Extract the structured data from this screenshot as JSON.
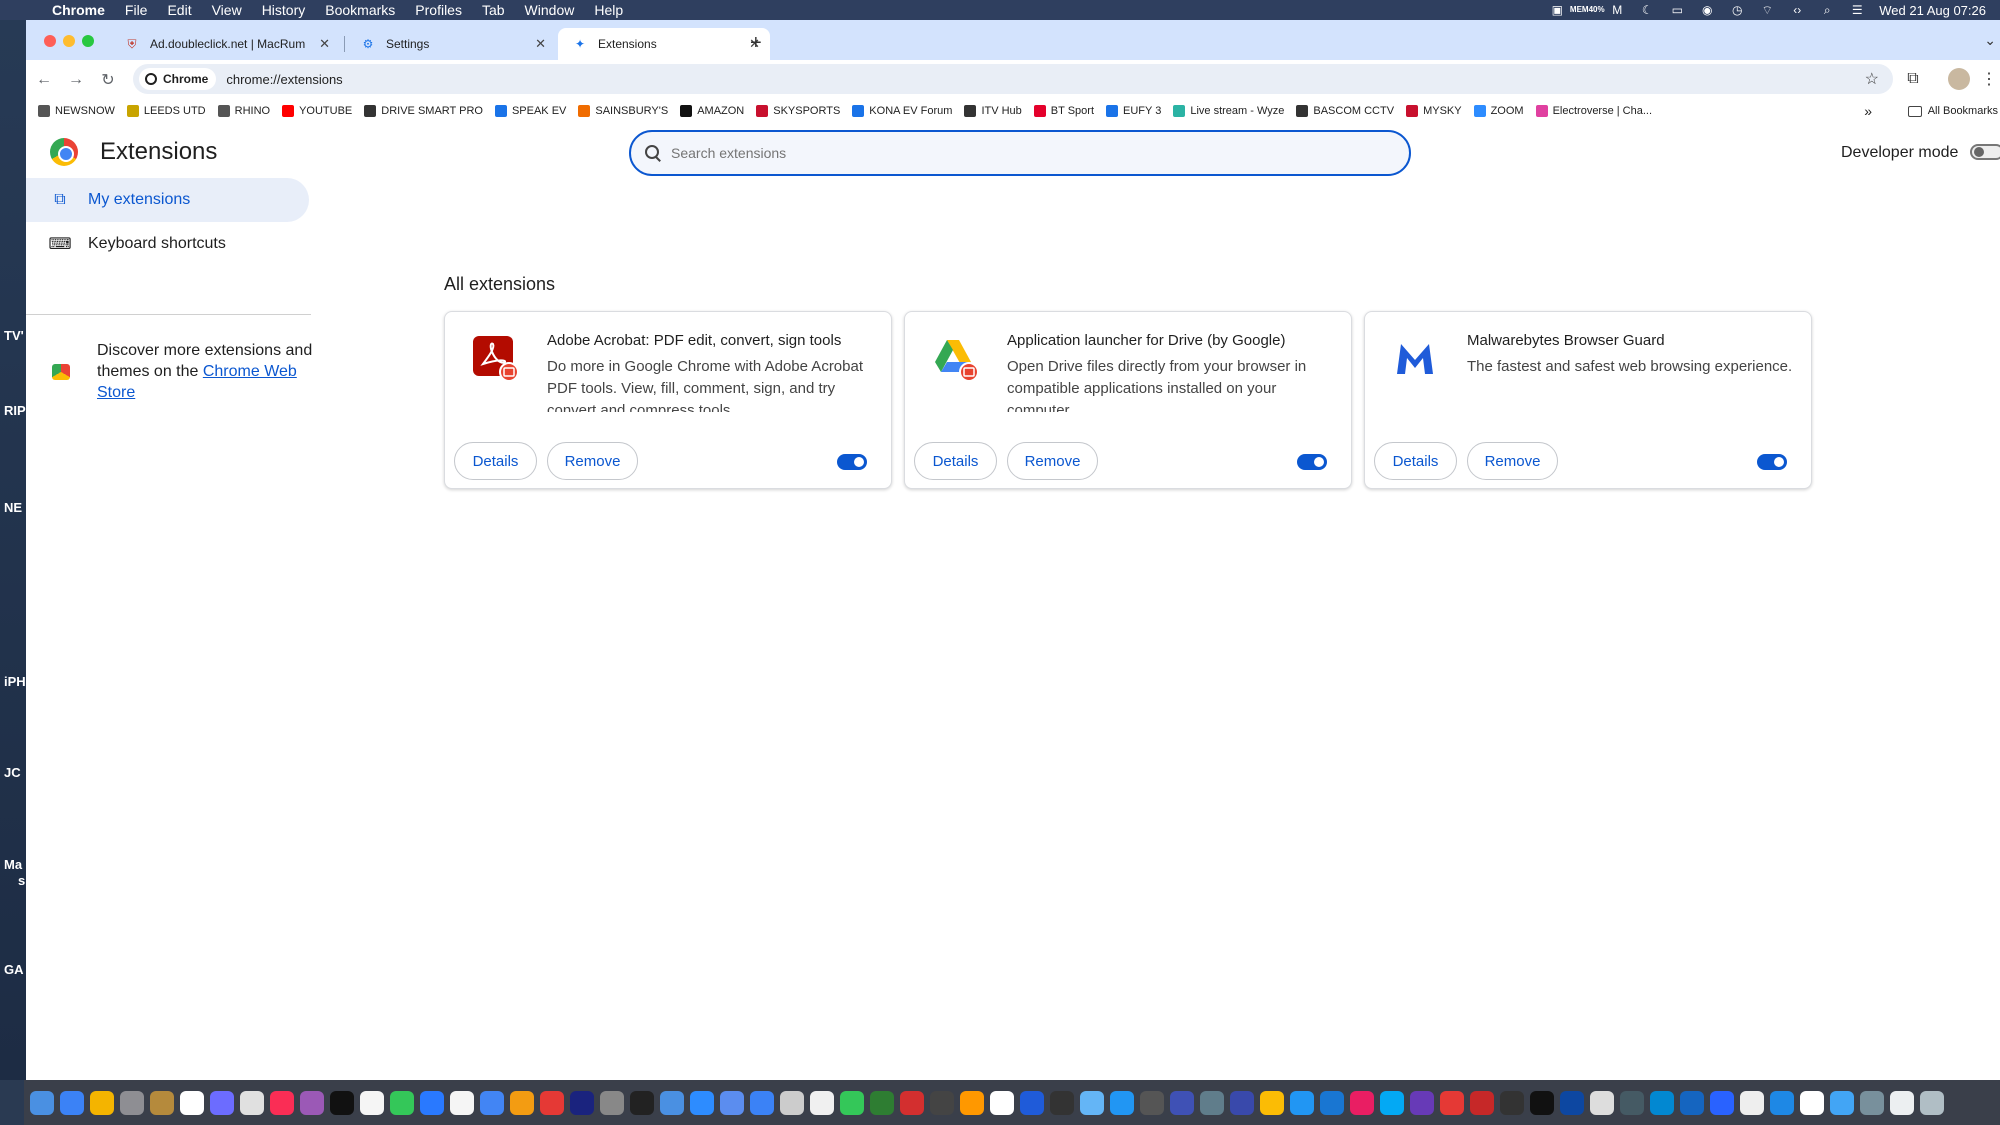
{
  "menubar": {
    "app": "Chrome",
    "items": [
      "File",
      "Edit",
      "View",
      "History",
      "Bookmarks",
      "Profiles",
      "Tab",
      "Window",
      "Help"
    ],
    "mem_label": "MEM",
    "mem_value": "40%",
    "clock": "Wed 21 Aug  07:26"
  },
  "desktop_labels": [
    "TV'",
    "RIP",
    "NE",
    "iPH",
    "JC",
    "Ma",
    "s",
    "GA"
  ],
  "tabs": [
    {
      "title": "Ad.doubleclick.net | MacRum",
      "icon": "shield-icon"
    },
    {
      "title": "Settings",
      "icon": "gear-icon"
    },
    {
      "title": "Extensions",
      "icon": "puzzle-icon"
    }
  ],
  "omnibox": {
    "chip": "Chrome",
    "url": "chrome://extensions"
  },
  "bookmarks": [
    {
      "label": "NEWSNOW",
      "color": "#555555"
    },
    {
      "label": "LEEDS UTD",
      "color": "#c8a400"
    },
    {
      "label": "RHINO",
      "color": "#555555"
    },
    {
      "label": "YOUTUBE",
      "color": "#ff0000"
    },
    {
      "label": "DRIVE SMART PRO",
      "color": "#333333"
    },
    {
      "label": "SPEAK EV",
      "color": "#1a73e8"
    },
    {
      "label": "SAINSBURY'S",
      "color": "#f06c00"
    },
    {
      "label": "AMAZON",
      "color": "#111111"
    },
    {
      "label": "SKYSPORTS",
      "color": "#c8102e"
    },
    {
      "label": "KONA EV Forum",
      "color": "#1a73e8"
    },
    {
      "label": "ITV Hub",
      "color": "#333333"
    },
    {
      "label": "BT Sport",
      "color": "#e4002b"
    },
    {
      "label": "EUFY 3",
      "color": "#1a73e8"
    },
    {
      "label": "Live stream - Wyze",
      "color": "#2bb3a4"
    },
    {
      "label": "BASCOM CCTV",
      "color": "#333333"
    },
    {
      "label": "MYSKY",
      "color": "#c8102e"
    },
    {
      "label": "ZOOM",
      "color": "#2d8cff"
    },
    {
      "label": "Electroverse | Cha...",
      "color": "#e040a0"
    }
  ],
  "bookmarks_more": "»",
  "all_bookmarks": "All Bookmarks",
  "page": {
    "title": "Extensions",
    "search_placeholder": "Search extensions",
    "developer_mode": "Developer mode",
    "developer_mode_on": false,
    "sidebar": [
      {
        "label": "My extensions",
        "selected": true
      },
      {
        "label": "Keyboard shortcuts",
        "selected": false
      }
    ],
    "discover_text": "Discover more extensions and themes on the ",
    "discover_link": "Chrome Web Store",
    "section_title": "All extensions",
    "extensions": [
      {
        "name": "Adobe Acrobat: PDF edit, convert, sign tools",
        "description": "Do more in Google Chrome with Adobe Acrobat PDF tools. View, fill, comment, sign, and try convert and compress tools.",
        "enabled": true,
        "icon": "adobe-acrobat-icon"
      },
      {
        "name": "Application launcher for Drive (by Google)",
        "description": "Open Drive files directly from your browser in compatible applications installed on your computer.",
        "enabled": true,
        "icon": "google-drive-icon"
      },
      {
        "name": "Malwarebytes Browser Guard",
        "description": "The fastest and safest web browsing experience.",
        "enabled": true,
        "icon": "malwarebytes-icon"
      }
    ],
    "details_label": "Details",
    "remove_label": "Remove"
  },
  "accent_color": "#0b57d0"
}
